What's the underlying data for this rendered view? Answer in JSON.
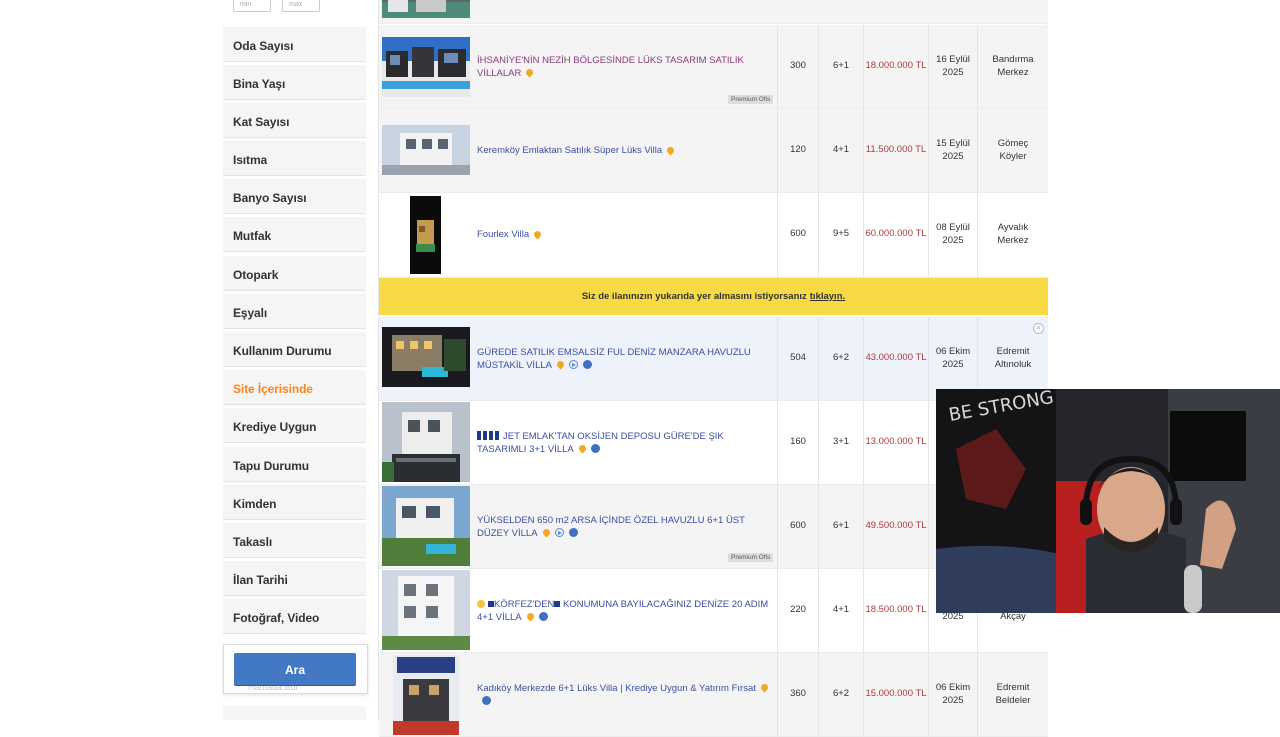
{
  "sidebar": {
    "range_min_placeholder": "min",
    "range_max_placeholder": "max",
    "filters": [
      {
        "label": "Oda Sayısı",
        "active": false
      },
      {
        "label": "Bina Yaşı",
        "active": false
      },
      {
        "label": "Kat Sayısı",
        "active": false
      },
      {
        "label": "Isıtma",
        "active": false
      },
      {
        "label": "Banyo Sayısı",
        "active": false
      },
      {
        "label": "Mutfak",
        "active": false
      },
      {
        "label": "Otopark",
        "active": false
      },
      {
        "label": "Eşyalı",
        "active": false
      },
      {
        "label": "Kullanım Durumu",
        "active": false
      },
      {
        "label": "Site İçerisinde",
        "active": true
      },
      {
        "label": "Krediye Uygun",
        "active": false
      },
      {
        "label": "Tapu Durumu",
        "active": false
      },
      {
        "label": "Kimden",
        "active": false
      },
      {
        "label": "Takaslı",
        "active": false
      },
      {
        "label": "İlan Tarihi",
        "active": false
      },
      {
        "label": "Fotoğraf, Video",
        "active": false
      }
    ],
    "search_button": "Ara",
    "ghost_text": "Haritada Bul"
  },
  "ad_banner": {
    "text": "Siz de ilanınızın yukarıda yer almasını istiyorsanız",
    "link": "tıklayın."
  },
  "listings": [
    {
      "title": "İHSANİYE'NİN NEZİH BÖLGESİNDE LÜKS TASARIM SATILIK VİLLALAR",
      "m2": "300",
      "rooms": "6+1",
      "price": "18.000.000 TL",
      "date": "16 Eylül 2025",
      "date_line1": "16 Eylül",
      "date_line2": "2025",
      "loc_line1": "Bandırma",
      "loc_line2": "Merkez",
      "badge": "Premium Ofis"
    },
    {
      "title": "Keremköy Emlaktan Satılık Süper Lüks Villa",
      "m2": "120",
      "rooms": "4+1",
      "price": "11.500.000 TL",
      "date_line1": "15 Eylül",
      "date_line2": "2025",
      "loc_line1": "Gömeç",
      "loc_line2": "Köyler"
    },
    {
      "title": "Fourlex Villa",
      "m2": "600",
      "rooms": "9+5",
      "price": "60.000.000 TL",
      "date_line1": "08 Eylül",
      "date_line2": "2025",
      "loc_line1": "Ayvalık",
      "loc_line2": "Merkez"
    },
    {
      "title": "GÜREDE SATILIK EMSALSİZ FUL DENİZ MANZARA HAVUZLU MÜSTAKİL VİLLA",
      "m2": "504",
      "rooms": "6+2",
      "price": "43.000.000 TL",
      "date_line1": "06 Ekim",
      "date_line2": "2025",
      "loc_line1": "Edremit",
      "loc_line2": "Altınoluk",
      "close": "×"
    },
    {
      "title": "JET EMLAK'TAN OKSİJEN DEPOSU GÜRE'DE ŞIK TASARIMLI 3+1 VİLLA",
      "m2": "160",
      "rooms": "3+1",
      "price": "13.000.000 TL"
    },
    {
      "title": "YÜKSELDEN 650 m2 ARSA İÇİNDE ÖZEL HAVUZLU 6+1 ÜST DÜZEY VİLLA",
      "m2": "600",
      "rooms": "6+1",
      "price": "49.500.000 TL",
      "badge": "Premium Ofis"
    },
    {
      "title_part1": "KÖRFEZ'DEN",
      "title_part2": "KONUMUNA BAYILACAĞINIZ DENİZE 20 ADIM 4+1 VİLLA",
      "m2": "220",
      "rooms": "4+1",
      "price": "18.500.000 TL",
      "date_line2": "2025",
      "loc_line2": "Akçay"
    },
    {
      "title": "Kadıköy Merkezde 6+1 Lüks Villa | Krediye Uygun & Yatırım Fırsat",
      "m2": "360",
      "rooms": "6+2",
      "price": "15.000.000 TL",
      "date_line1": "06 Ekim",
      "date_line2": "2025",
      "loc_line1": "Edremit",
      "loc_line2": "Beldeler"
    }
  ],
  "colors": {
    "accent_orange": "#f7861b",
    "button_blue": "#4378c4",
    "price_red": "#b23a3a",
    "title_blue": "#3a4fa1",
    "banner_yellow": "#f7da45"
  },
  "webcam": {
    "poster_text": "BE STRONG"
  }
}
